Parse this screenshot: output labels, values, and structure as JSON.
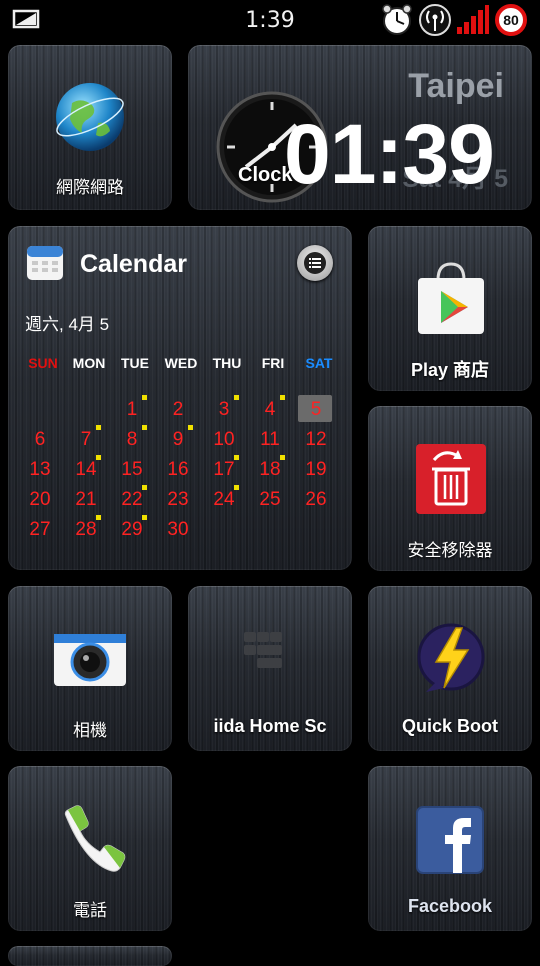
{
  "status_bar": {
    "time": "1:39",
    "battery": "80"
  },
  "clock_widget": {
    "city": "Taipei",
    "time": "01:39",
    "date": "Sat 4月 5",
    "label": "Clock"
  },
  "tiles": {
    "internet": "網際網路",
    "play_store": "Play 商店",
    "uninstaller": "安全移除器",
    "camera": "相機",
    "iida": "iida Home Sc",
    "quick_boot": "Quick Boot",
    "phone": "電話",
    "facebook": "Facebook"
  },
  "calendar": {
    "title": "Calendar",
    "date_line": "週六, 4月 5",
    "weekdays": [
      "SUN",
      "MON",
      "TUE",
      "WED",
      "THU",
      "FRI",
      "SAT"
    ],
    "weekday_colors": [
      "#e01010",
      "#ffffff",
      "#ffffff",
      "#ffffff",
      "#ffffff",
      "#ffffff",
      "#1a8cff"
    ],
    "today": 5,
    "event_days": [
      1,
      3,
      4,
      7,
      8,
      9,
      14,
      17,
      18,
      22,
      24,
      28,
      29
    ],
    "weeks": [
      [
        "",
        "",
        "1",
        "2",
        "3",
        "4",
        "5"
      ],
      [
        "6",
        "7",
        "8",
        "9",
        "10",
        "11",
        "12"
      ],
      [
        "13",
        "14",
        "15",
        "16",
        "17",
        "18",
        "19"
      ],
      [
        "20",
        "21",
        "22",
        "23",
        "24",
        "25",
        "26"
      ],
      [
        "27",
        "28",
        "29",
        "30",
        "",
        "",
        ""
      ]
    ]
  },
  "colors": {
    "day_number": "#ff2222",
    "event_marker": "#f0e000",
    "battery_ring": "#e01010"
  }
}
